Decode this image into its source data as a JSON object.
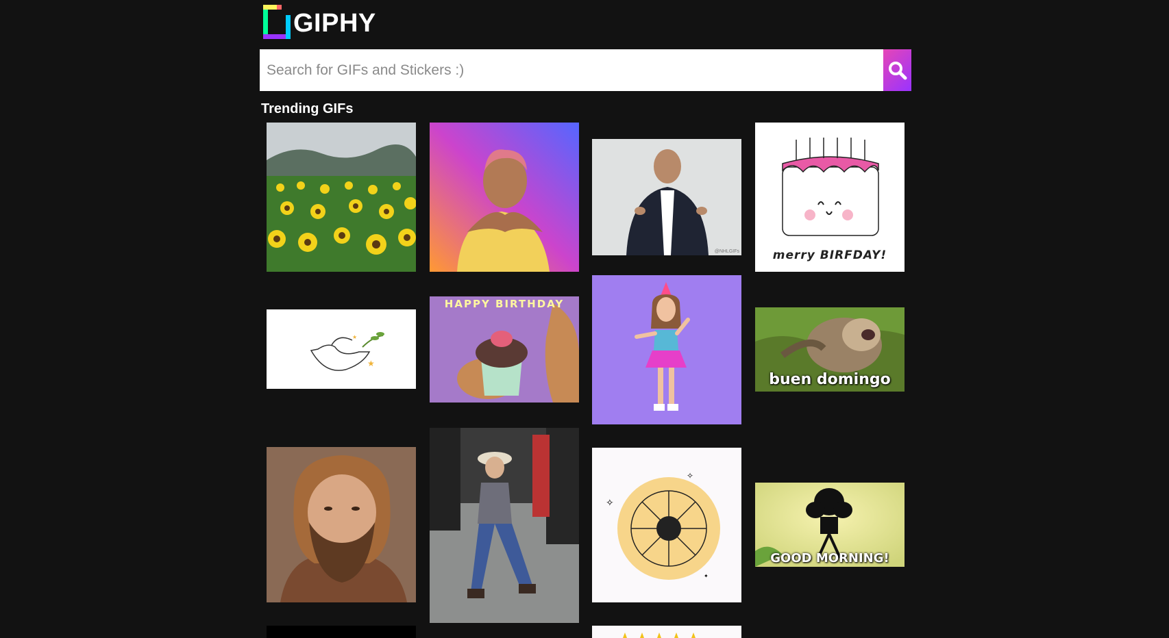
{
  "header": {
    "logo_text": "GIPHY"
  },
  "search": {
    "placeholder": "Search for GIFs and Stickers :)"
  },
  "trending": {
    "title": "Trending GIFs",
    "gifs": [
      {
        "subject": "sunflower field"
      },
      {
        "subject": "man blowing kiss"
      },
      {
        "subject": "man in suit dancing",
        "watermark": "@NHLGIFs"
      },
      {
        "subject": "birthday cake",
        "caption": "merry BIRFDAY!"
      },
      {
        "subject": "peace dove"
      },
      {
        "subject": "birthday cupcake",
        "caption": "HAPPY BIRTHDAY"
      },
      {
        "subject": "party girl dancing"
      },
      {
        "subject": "sloth",
        "caption": "buen domingo"
      },
      {
        "subject": "bearded man smiling"
      },
      {
        "subject": "cowboy kid dancing"
      },
      {
        "subject": "sunflower illustration"
      },
      {
        "subject": "good morning silhouette",
        "caption": "GOOD MORNING!"
      },
      {
        "subject": "dark gif"
      },
      {
        "subject": "yellow illustration"
      }
    ]
  },
  "colors": {
    "background": "#121212",
    "search_button_gradient": [
      "#e646b6",
      "#9933ff"
    ]
  },
  "icons": {
    "search": "search-icon",
    "logo": "giphy-logo-icon"
  }
}
